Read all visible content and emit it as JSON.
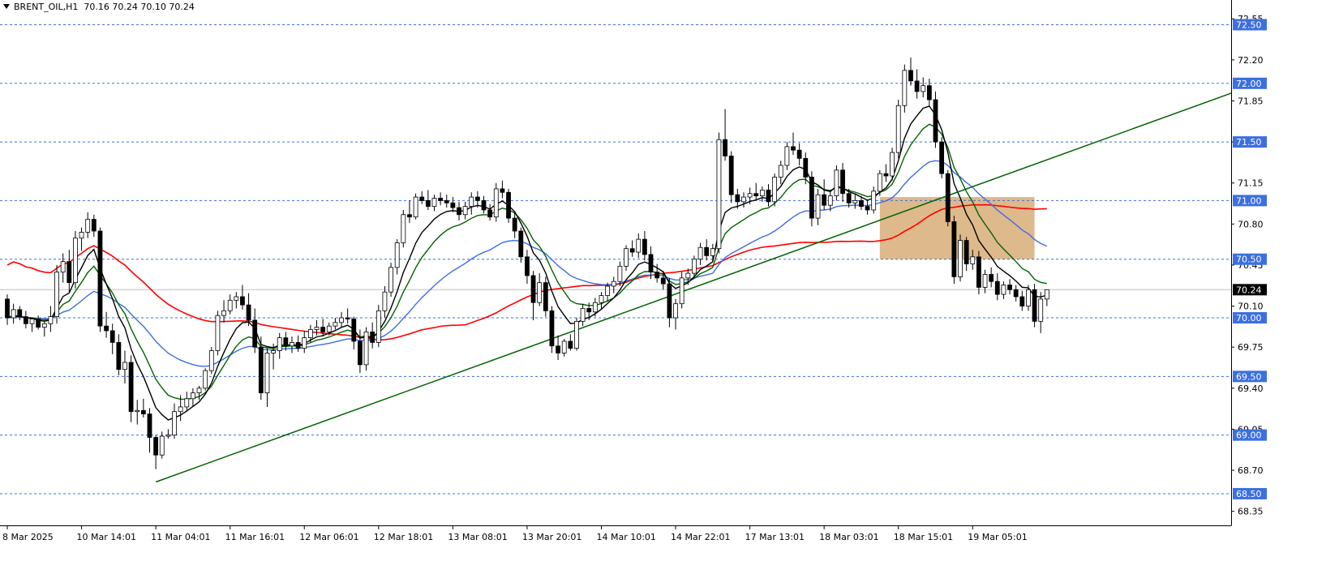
{
  "header": {
    "symbol": "BRENT_OIL,H1",
    "ohlc": "70.16 70.24 70.10 70.24"
  },
  "colors": {
    "background": "#ffffff",
    "bull_candle": "#ffffff",
    "bear_candle": "#000000",
    "wick": "#000000",
    "ma_fast": "#000000",
    "ma_mid": "#006400",
    "ma_slow": "#3c6fe0",
    "ma_long": "#ff0000",
    "trendline": "#006400",
    "level_line": "#3c6fe0",
    "zone_fill": "#d2a264",
    "price_label_bg": "#3c6fe0",
    "current_label_bg": "#000000"
  },
  "chart_data": {
    "type": "candlestick",
    "symbol": "BRENT_OIL",
    "timeframe": "H1",
    "ylim": [
      68.23,
      72.6
    ],
    "y_ticks": [
      72.55,
      72.2,
      71.85,
      71.5,
      71.15,
      70.8,
      70.45,
      70.1,
      69.75,
      69.4,
      69.05,
      68.7,
      68.35
    ],
    "x_ticks": [
      {
        "label": "8 Mar 2025",
        "index": 0
      },
      {
        "label": "10 Mar 14:01",
        "index": 12
      },
      {
        "label": "11 Mar 04:01",
        "index": 24
      },
      {
        "label": "11 Mar 16:01",
        "index": 36
      },
      {
        "label": "12 Mar 06:01",
        "index": 48
      },
      {
        "label": "12 Mar 18:01",
        "index": 60
      },
      {
        "label": "13 Mar 08:01",
        "index": 72
      },
      {
        "label": "13 Mar 20:01",
        "index": 84
      },
      {
        "label": "14 Mar 10:01",
        "index": 96
      },
      {
        "label": "14 Mar 22:01",
        "index": 108
      },
      {
        "label": "17 Mar 13:01",
        "index": 120
      },
      {
        "label": "18 Mar 03:01",
        "index": 132
      },
      {
        "label": "18 Mar 15:01",
        "index": 144
      },
      {
        "label": "19 Mar 05:01",
        "index": 156
      }
    ],
    "levels": [
      {
        "value": 72.5,
        "label": "72.50"
      },
      {
        "value": 72.0,
        "label": "72.00"
      },
      {
        "value": 71.5,
        "label": "71.50"
      },
      {
        "value": 71.0,
        "label": "71.00"
      },
      {
        "value": 70.5,
        "label": "70.50"
      },
      {
        "value": 70.0,
        "label": "70.00"
      },
      {
        "value": 69.5,
        "label": "69.50"
      },
      {
        "value": 69.0,
        "label": "69.00"
      },
      {
        "value": 68.5,
        "label": "68.50"
      }
    ],
    "current_price": {
      "value": 70.24,
      "label": "70.24"
    },
    "trendline": {
      "from": {
        "index": 24,
        "price": 68.6
      },
      "to": {
        "index": 198,
        "price": 71.92
      }
    },
    "zone": {
      "from_index": 141,
      "to_index": 166,
      "high": 71.03,
      "low": 70.5
    },
    "candles": [
      [
        70.16,
        70.2,
        69.94,
        70.0
      ],
      [
        70.0,
        70.12,
        69.95,
        70.07
      ],
      [
        70.07,
        70.1,
        69.98,
        70.01
      ],
      [
        70.01,
        70.06,
        69.91,
        69.95
      ],
      [
        69.95,
        70.0,
        69.88,
        69.99
      ],
      [
        69.99,
        70.02,
        69.9,
        69.92
      ],
      [
        69.92,
        69.97,
        69.84,
        69.95
      ],
      [
        69.95,
        70.1,
        69.88,
        70.01
      ],
      [
        70.01,
        70.45,
        69.95,
        70.39
      ],
      [
        70.39,
        70.55,
        70.3,
        70.48
      ],
      [
        70.48,
        70.58,
        70.22,
        70.3
      ],
      [
        70.3,
        70.74,
        70.25,
        70.68
      ],
      [
        70.68,
        70.77,
        70.57,
        70.73
      ],
      [
        70.73,
        70.9,
        70.68,
        70.84
      ],
      [
        70.84,
        70.88,
        70.69,
        70.74
      ],
      [
        70.74,
        70.77,
        69.88,
        69.93
      ],
      [
        69.93,
        70.05,
        69.83,
        69.89
      ],
      [
        69.89,
        69.95,
        69.69,
        69.79
      ],
      [
        69.79,
        69.86,
        69.51,
        69.56
      ],
      [
        69.56,
        69.72,
        69.44,
        69.62
      ],
      [
        69.62,
        69.68,
        69.11,
        69.2
      ],
      [
        69.2,
        69.3,
        69.09,
        69.21
      ],
      [
        69.21,
        69.31,
        69.15,
        69.18
      ],
      [
        69.18,
        69.23,
        68.85,
        68.98
      ],
      [
        68.98,
        69.0,
        68.71,
        68.83
      ],
      [
        68.83,
        69.03,
        68.8,
        68.99
      ],
      [
        68.99,
        69.05,
        68.97,
        69.0
      ],
      [
        69.0,
        69.27,
        68.97,
        69.2
      ],
      [
        69.2,
        69.34,
        69.12,
        69.24
      ],
      [
        69.24,
        69.37,
        69.2,
        69.31
      ],
      [
        69.31,
        69.4,
        69.24,
        69.36
      ],
      [
        69.36,
        69.42,
        69.3,
        69.4
      ],
      [
        69.4,
        69.57,
        69.38,
        69.55
      ],
      [
        69.55,
        69.75,
        69.52,
        69.72
      ],
      [
        69.72,
        70.06,
        69.68,
        70.02
      ],
      [
        70.02,
        70.15,
        69.96,
        70.06
      ],
      [
        70.06,
        70.2,
        70.03,
        70.15
      ],
      [
        70.15,
        70.22,
        70.08,
        70.18
      ],
      [
        70.18,
        70.28,
        70.07,
        70.11
      ],
      [
        70.11,
        70.21,
        69.93,
        69.98
      ],
      [
        69.98,
        70.08,
        69.7,
        69.75
      ],
      [
        69.75,
        69.84,
        69.3,
        69.36
      ],
      [
        69.36,
        69.74,
        69.24,
        69.7
      ],
      [
        69.7,
        69.78,
        69.56,
        69.72
      ],
      [
        69.72,
        69.87,
        69.65,
        69.83
      ],
      [
        69.83,
        69.88,
        69.72,
        69.76
      ],
      [
        69.76,
        69.84,
        69.7,
        69.79
      ],
      [
        69.79,
        69.85,
        69.71,
        69.74
      ],
      [
        69.74,
        69.89,
        69.7,
        69.83
      ],
      [
        69.83,
        69.94,
        69.79,
        69.9
      ],
      [
        69.9,
        69.98,
        69.85,
        69.92
      ],
      [
        69.92,
        69.99,
        69.84,
        69.88
      ],
      [
        69.88,
        69.96,
        69.85,
        69.93
      ],
      [
        69.93,
        70.0,
        69.9,
        69.96
      ],
      [
        69.96,
        70.05,
        69.92,
        70.0
      ],
      [
        70.0,
        70.08,
        69.95,
        69.99
      ],
      [
        69.99,
        70.01,
        69.73,
        69.8
      ],
      [
        69.8,
        69.9,
        69.53,
        69.6
      ],
      [
        69.6,
        69.92,
        69.55,
        69.88
      ],
      [
        69.88,
        69.96,
        69.74,
        69.79
      ],
      [
        69.79,
        70.11,
        69.75,
        70.06
      ],
      [
        70.06,
        70.27,
        70.0,
        70.22
      ],
      [
        70.22,
        70.47,
        70.18,
        70.43
      ],
      [
        70.43,
        70.67,
        70.37,
        70.64
      ],
      [
        70.64,
        70.92,
        70.6,
        70.88
      ],
      [
        70.88,
        71.0,
        70.81,
        70.86
      ],
      [
        70.86,
        71.06,
        70.84,
        71.03
      ],
      [
        71.03,
        71.08,
        70.97,
        71.0
      ],
      [
        71.0,
        71.09,
        70.92,
        70.95
      ],
      [
        70.95,
        71.05,
        70.91,
        71.02
      ],
      [
        71.02,
        71.07,
        70.96,
        71.0
      ],
      [
        71.0,
        71.05,
        70.94,
        70.98
      ],
      [
        70.98,
        71.03,
        70.9,
        70.94
      ],
      [
        70.94,
        70.99,
        70.83,
        70.88
      ],
      [
        70.88,
        70.99,
        70.84,
        70.95
      ],
      [
        70.95,
        71.07,
        70.88,
        71.03
      ],
      [
        71.03,
        71.08,
        70.94,
        71.0
      ],
      [
        71.0,
        71.04,
        70.89,
        70.92
      ],
      [
        70.92,
        70.97,
        70.83,
        70.86
      ],
      [
        70.86,
        71.15,
        70.82,
        71.1
      ],
      [
        71.1,
        71.17,
        71.02,
        71.07
      ],
      [
        71.07,
        71.1,
        70.81,
        70.85
      ],
      [
        70.85,
        70.9,
        70.68,
        70.74
      ],
      [
        70.74,
        70.77,
        70.47,
        70.52
      ],
      [
        70.52,
        70.58,
        70.29,
        70.36
      ],
      [
        70.36,
        70.4,
        69.98,
        70.13
      ],
      [
        70.13,
        70.38,
        70.1,
        70.3
      ],
      [
        70.3,
        70.35,
        70.01,
        70.06
      ],
      [
        70.06,
        70.1,
        69.7,
        69.76
      ],
      [
        69.76,
        69.85,
        69.64,
        69.7
      ],
      [
        69.7,
        69.82,
        69.67,
        69.8
      ],
      [
        69.8,
        69.86,
        69.72,
        69.74
      ],
      [
        69.74,
        70.0,
        69.72,
        69.97
      ],
      [
        69.97,
        70.12,
        69.93,
        70.08
      ],
      [
        70.08,
        70.13,
        69.98,
        70.05
      ],
      [
        70.05,
        70.17,
        70.01,
        70.13
      ],
      [
        70.13,
        70.22,
        70.08,
        70.19
      ],
      [
        70.19,
        70.3,
        70.14,
        70.27
      ],
      [
        70.27,
        70.35,
        70.21,
        70.31
      ],
      [
        70.31,
        70.48,
        70.27,
        70.44
      ],
      [
        70.44,
        70.62,
        70.4,
        70.59
      ],
      [
        70.59,
        70.66,
        70.52,
        70.56
      ],
      [
        70.56,
        70.72,
        70.51,
        70.67
      ],
      [
        70.67,
        70.74,
        70.49,
        70.54
      ],
      [
        70.54,
        70.61,
        70.33,
        70.39
      ],
      [
        70.39,
        70.46,
        70.3,
        70.34
      ],
      [
        70.34,
        70.4,
        70.24,
        70.29
      ],
      [
        70.29,
        70.34,
        69.92,
        70.0
      ],
      [
        70.0,
        70.16,
        69.9,
        70.12
      ],
      [
        70.12,
        70.39,
        70.08,
        70.34
      ],
      [
        70.34,
        70.42,
        70.28,
        70.38
      ],
      [
        70.38,
        70.53,
        70.34,
        70.5
      ],
      [
        70.5,
        70.64,
        70.45,
        70.6
      ],
      [
        70.6,
        70.67,
        70.49,
        70.53
      ],
      [
        70.53,
        70.63,
        70.48,
        70.59
      ],
      [
        70.59,
        71.58,
        70.55,
        71.52
      ],
      [
        71.52,
        71.78,
        71.34,
        71.38
      ],
      [
        71.38,
        71.42,
        70.98,
        71.05
      ],
      [
        71.05,
        71.1,
        70.93,
        70.99
      ],
      [
        70.99,
        71.07,
        70.94,
        71.03
      ],
      [
        71.03,
        71.11,
        70.97,
        71.06
      ],
      [
        71.06,
        71.15,
        71.0,
        71.04
      ],
      [
        71.04,
        71.12,
        70.99,
        71.09
      ],
      [
        71.09,
        71.14,
        70.95,
        70.99
      ],
      [
        70.99,
        71.23,
        70.95,
        71.2
      ],
      [
        71.2,
        71.34,
        71.14,
        71.3
      ],
      [
        71.3,
        71.5,
        71.26,
        71.46
      ],
      [
        71.46,
        71.58,
        71.39,
        71.43
      ],
      [
        71.43,
        71.49,
        71.3,
        71.36
      ],
      [
        71.36,
        71.41,
        71.14,
        71.2
      ],
      [
        71.2,
        71.25,
        70.78,
        70.85
      ],
      [
        70.85,
        71.1,
        70.79,
        71.05
      ],
      [
        71.05,
        71.18,
        70.92,
        70.96
      ],
      [
        70.96,
        71.09,
        70.91,
        71.04
      ],
      [
        71.04,
        71.3,
        71.0,
        71.26
      ],
      [
        71.26,
        71.32,
        70.99,
        71.06
      ],
      [
        71.06,
        71.1,
        70.94,
        70.98
      ],
      [
        70.98,
        71.05,
        70.93,
        71.0
      ],
      [
        71.0,
        71.04,
        70.92,
        70.95
      ],
      [
        70.95,
        71.0,
        70.88,
        70.92
      ],
      [
        70.92,
        71.12,
        70.89,
        71.08
      ],
      [
        71.08,
        71.26,
        71.04,
        71.23
      ],
      [
        71.23,
        71.31,
        71.16,
        71.21
      ],
      [
        71.21,
        71.45,
        71.17,
        71.41
      ],
      [
        71.41,
        71.86,
        71.36,
        71.81
      ],
      [
        71.81,
        72.16,
        71.75,
        72.11
      ],
      [
        72.11,
        72.22,
        71.98,
        72.02
      ],
      [
        72.02,
        72.12,
        71.87,
        71.93
      ],
      [
        71.93,
        72.05,
        71.88,
        71.98
      ],
      [
        71.98,
        72.04,
        71.8,
        71.86
      ],
      [
        71.86,
        71.93,
        71.45,
        71.5
      ],
      [
        71.5,
        71.54,
        71.19,
        71.23
      ],
      [
        71.23,
        71.26,
        70.78,
        70.82
      ],
      [
        70.82,
        70.87,
        70.29,
        70.35
      ],
      [
        70.35,
        70.71,
        70.31,
        70.66
      ],
      [
        70.66,
        70.69,
        70.4,
        70.46
      ],
      [
        70.46,
        70.58,
        70.41,
        70.52
      ],
      [
        70.52,
        70.57,
        70.2,
        70.26
      ],
      [
        70.26,
        70.41,
        70.21,
        70.37
      ],
      [
        70.37,
        70.43,
        70.26,
        70.31
      ],
      [
        70.31,
        70.38,
        70.15,
        70.2
      ],
      [
        70.2,
        70.31,
        70.16,
        70.28
      ],
      [
        70.28,
        70.33,
        70.2,
        70.24
      ],
      [
        70.24,
        70.28,
        70.14,
        70.18
      ],
      [
        70.18,
        70.23,
        70.06,
        70.1
      ],
      [
        70.1,
        70.28,
        70.06,
        70.24
      ],
      [
        70.24,
        70.29,
        69.92,
        69.97
      ],
      [
        69.97,
        70.22,
        69.87,
        70.16
      ],
      [
        70.16,
        70.24,
        70.1,
        70.24
      ]
    ]
  }
}
